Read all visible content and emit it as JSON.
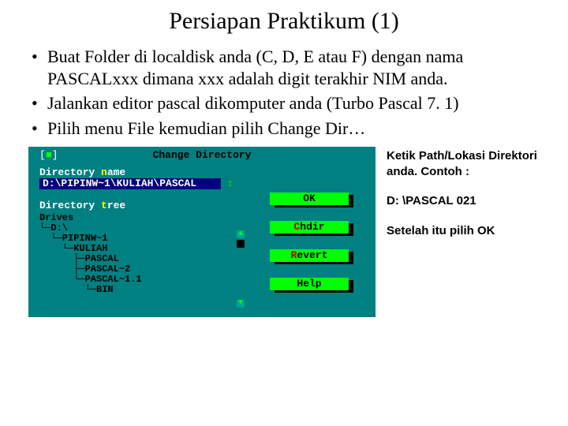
{
  "title": "Persiapan Praktikum (1)",
  "bullets": [
    "Buat Folder di localdisk anda (C, D, E atau F) dengan nama PASCALxxx dimana xxx adalah digit terakhir NIM anda.",
    "Jalankan editor pascal dikomputer anda (Turbo Pascal 7. 1)",
    "Pilih menu File kemudian pilih Change Dir…"
  ],
  "dialog": {
    "title": "Change Directory",
    "close_glyph": "[■]",
    "dir_name_label_pre": "Directory ",
    "dir_name_hotkey": "n",
    "dir_name_label_post": "ame",
    "dir_value": "D:\\PIPINW~1\\KULIAH\\PASCAL",
    "arrow": "↕",
    "tree_label_pre": "Directory ",
    "tree_hotkey": "t",
    "tree_label_post": "ree",
    "tree_text": "Drives\n└─D:\\\n  └─PIPINW~1\n    └─KULIAH\n      ├─PASCAL\n      ├─PASCAL~2\n      └─PASCAL~1.1\n        └─BIN",
    "buttons": {
      "ok": "OK",
      "chdir_hk": "C",
      "chdir_rest": "hdir",
      "revert_hk": "R",
      "revert_rest": "evert",
      "help": "Help"
    }
  },
  "notes": {
    "line1": "Ketik  Path/Lokasi Direktori anda. Contoh :",
    "line2": "D: \\PASCAL 021",
    "line3": "Setelah itu pilih OK"
  }
}
